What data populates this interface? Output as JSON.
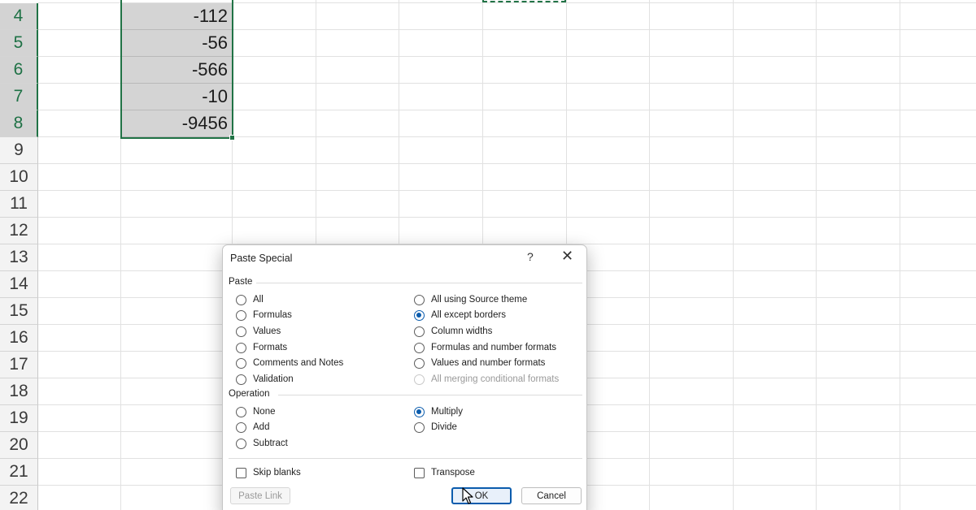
{
  "sheet": {
    "row_numbers": [
      "4",
      "5",
      "6",
      "7",
      "8",
      "9",
      "10",
      "11",
      "12",
      "13",
      "14",
      "15",
      "16",
      "17",
      "18",
      "19",
      "20",
      "21",
      "22"
    ],
    "cells": [
      "-112",
      "-56",
      "-566",
      "-10",
      "-9456"
    ]
  },
  "dialog": {
    "title": "Paste Special",
    "help": "?",
    "close": "✕",
    "paste_group": "Paste",
    "paste_left": [
      "All",
      "Formulas",
      "Values",
      "Formats",
      "Comments and Notes",
      "Validation"
    ],
    "paste_right": [
      "All using Source theme",
      "All except borders",
      "Column widths",
      "Formulas and number formats",
      "Values and number formats",
      "All merging conditional formats"
    ],
    "paste_selected": "All except borders",
    "operation_group": "Operation",
    "operation_left": [
      "None",
      "Add",
      "Subtract"
    ],
    "operation_right": [
      "Multiply",
      "Divide"
    ],
    "operation_selected": "Multiply",
    "skip_blanks": "Skip blanks",
    "transpose": "Transpose",
    "paste_link": "Paste Link",
    "ok": "OK",
    "cancel": "Cancel"
  },
  "colors": {
    "selection": "#217346",
    "radio_accent": "#0b5cad"
  }
}
